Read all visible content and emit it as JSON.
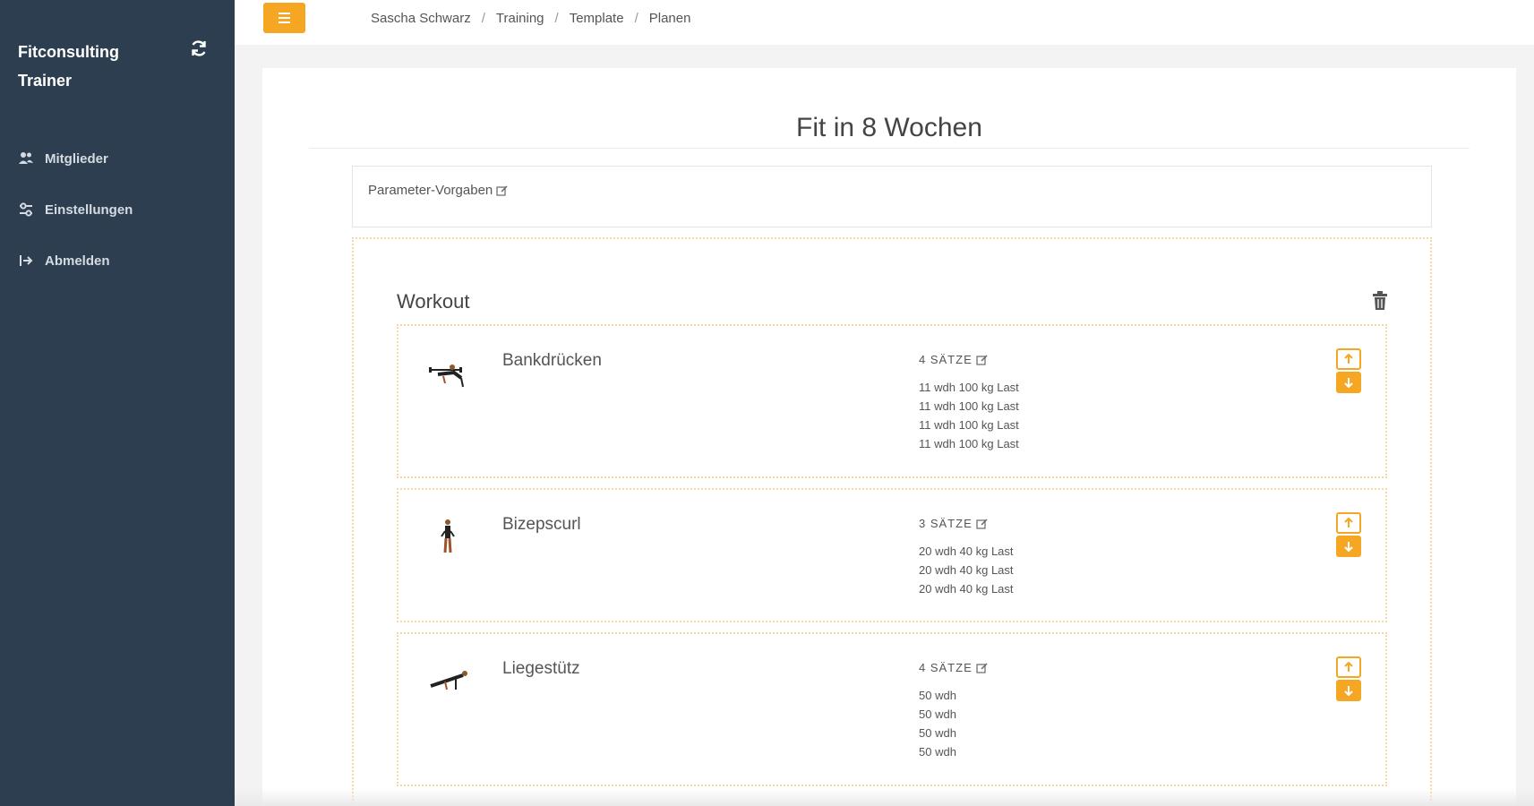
{
  "sidebar": {
    "brand_line1": "Fitconsulting",
    "brand_line2": "Trainer",
    "items": [
      {
        "label": "Mitglieder",
        "icon": "users-icon"
      },
      {
        "label": "Einstellungen",
        "icon": "settings-icon"
      },
      {
        "label": "Abmelden",
        "icon": "logout-icon"
      }
    ]
  },
  "topbar": {
    "breadcrumb": [
      "Sascha Schwarz",
      "Training",
      "Template",
      "Planen"
    ],
    "separator": "/"
  },
  "main": {
    "title": "Fit in 8 Wochen",
    "params_label": "Parameter-Vorgaben",
    "workout": {
      "title": "Workout",
      "exercises": [
        {
          "name": "Bankdrücken",
          "sets_label": "4 SÄTZE",
          "reps": [
            "11 wdh 100 kg Last",
            "11 wdh 100 kg Last",
            "11 wdh 100 kg Last",
            "11 wdh 100 kg Last"
          ]
        },
        {
          "name": "Bizepscurl",
          "sets_label": "3 SÄTZE",
          "reps": [
            "20 wdh 40 kg Last",
            "20 wdh 40 kg Last",
            "20 wdh 40 kg Last"
          ]
        },
        {
          "name": "Liegestütz",
          "sets_label": "4 SÄTZE",
          "reps": [
            "50 wdh",
            "50 wdh",
            "50 wdh",
            "50 wdh"
          ]
        }
      ]
    }
  },
  "colors": {
    "sidebar_bg": "#2c3e50",
    "accent": "#f5a623",
    "dotted_border": "#f9d7a0"
  }
}
